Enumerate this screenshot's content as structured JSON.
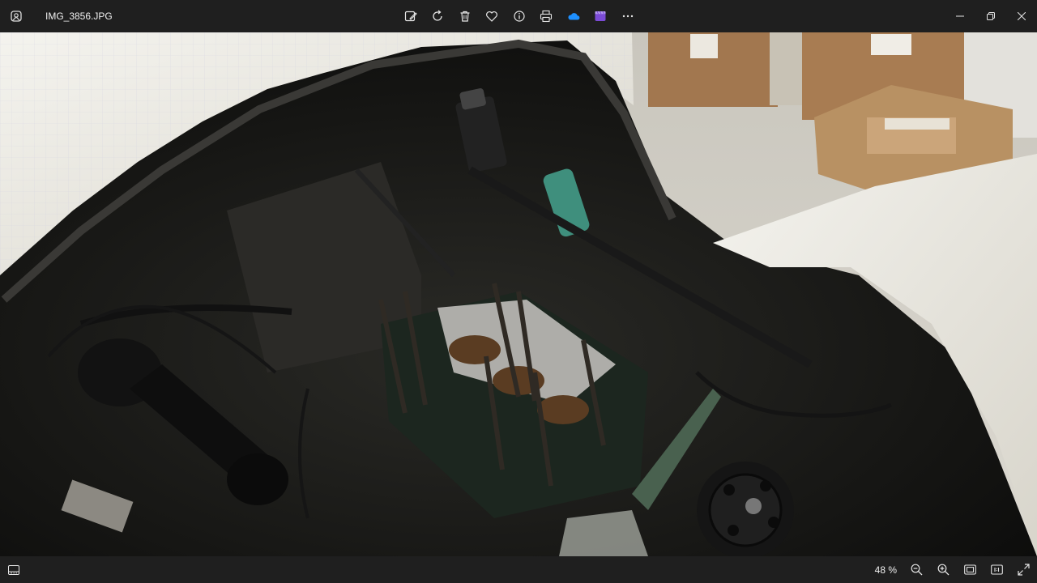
{
  "window": {
    "filename": "IMG_3856.JPG",
    "app_icon": "photos-icon"
  },
  "toolbar": {
    "items": [
      {
        "name": "edit-image",
        "icon": "edit-image-icon"
      },
      {
        "name": "rotate",
        "icon": "rotate-icon"
      },
      {
        "name": "delete",
        "icon": "trash-icon"
      },
      {
        "name": "favorite",
        "icon": "heart-icon"
      },
      {
        "name": "file-info",
        "icon": "info-icon"
      },
      {
        "name": "print",
        "icon": "printer-icon"
      },
      {
        "name": "onedrive",
        "icon": "cloud-icon"
      },
      {
        "name": "clipchamp",
        "icon": "clipchamp-icon"
      },
      {
        "name": "see-more",
        "icon": "more-icon"
      }
    ]
  },
  "window_controls": [
    "minimize",
    "maximize",
    "close"
  ],
  "bottombar": {
    "zoom_level": "48 %",
    "buttons": [
      "zoom-out",
      "zoom-in",
      "fit-to-window",
      "actual-size",
      "full-screen"
    ]
  },
  "photo": {
    "subject": "vintage car engine bay with cylinder block"
  },
  "colors": {
    "chrome_bg": "#1f1f1f",
    "onedrive_blue": "#1e90ff",
    "clipchamp_purple": "#7b4bd6"
  }
}
